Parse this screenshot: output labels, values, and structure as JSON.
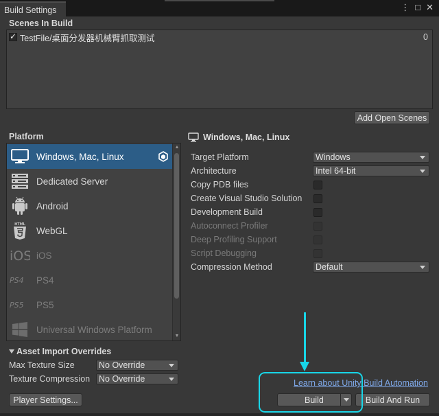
{
  "window": {
    "tab_title": "Build Settings",
    "controls": {
      "menu_icon": "⋮",
      "maximize_icon": "□",
      "close_icon": "✕"
    }
  },
  "scenes": {
    "title": "Scenes In Build",
    "items": [
      {
        "checked": true,
        "name": "TestFile/桌面分发器机械臂抓取测试",
        "index": "0"
      }
    ],
    "add_open_scenes_label": "Add Open Scenes"
  },
  "platform": {
    "title": "Platform",
    "items": [
      {
        "label": "Windows, Mac, Linux",
        "icon": "monitor-icon",
        "selected": true,
        "enabled": true
      },
      {
        "label": "Dedicated Server",
        "icon": "server-icon",
        "selected": false,
        "enabled": true
      },
      {
        "label": "Android",
        "icon": "android-icon",
        "selected": false,
        "enabled": true
      },
      {
        "label": "WebGL",
        "icon": "html5-icon",
        "selected": false,
        "enabled": true
      },
      {
        "label": "iOS",
        "icon": "ios-icon",
        "selected": false,
        "enabled": false
      },
      {
        "label": "PS4",
        "icon": "ps4-icon",
        "selected": false,
        "enabled": false
      },
      {
        "label": "PS5",
        "icon": "ps5-icon",
        "selected": false,
        "enabled": false
      },
      {
        "label": "Universal Windows Platform",
        "icon": "windows-logo-icon",
        "selected": false,
        "enabled": false
      }
    ]
  },
  "settings": {
    "header": "Windows, Mac, Linux",
    "target_platform_label": "Target Platform",
    "target_platform_value": "Windows",
    "architecture_label": "Architecture",
    "architecture_value": "Intel 64-bit",
    "copy_pdb_label": "Copy PDB files",
    "create_vs_label": "Create Visual Studio Solution",
    "development_build_label": "Development Build",
    "autoconnect_label": "Autoconnect Profiler",
    "deep_profiling_label": "Deep Profiling Support",
    "script_debugging_label": "Script Debugging",
    "compression_label": "Compression Method",
    "compression_value": "Default"
  },
  "asset_import": {
    "title": "Asset Import Overrides",
    "max_texture_label": "Max Texture Size",
    "max_texture_value": "No Override",
    "texture_compression_label": "Texture Compression",
    "texture_compression_value": "No Override"
  },
  "footer": {
    "player_settings_label": "Player Settings...",
    "learn_link": "Learn about Unity Build Automation",
    "build_label": "Build",
    "build_and_run_label": "Build And Run"
  },
  "colors": {
    "background": "#383838",
    "selection": "#2c5d87",
    "annotation": "#18d6e8",
    "link": "#7fa8e8"
  }
}
